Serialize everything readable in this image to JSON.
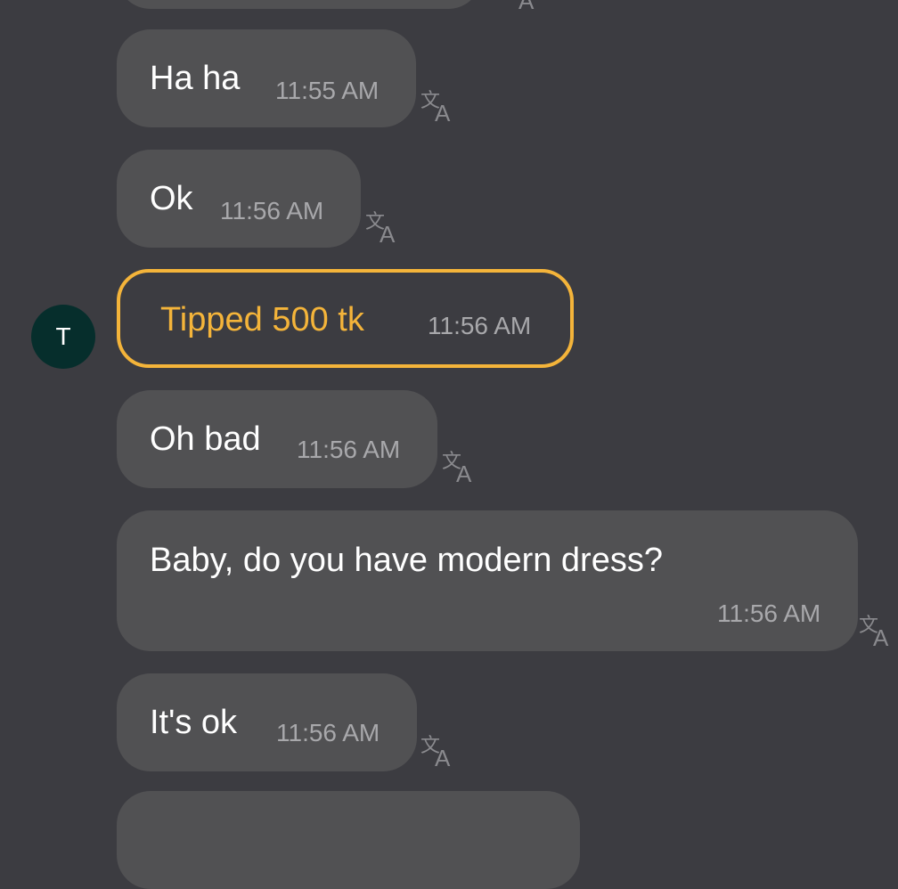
{
  "messages": [
    {
      "text": "Ha ha",
      "time": "11:55 AM"
    },
    {
      "text": "Ok",
      "time": "11:56 AM"
    },
    {
      "text": "Oh bad",
      "time": "11:56 AM"
    },
    {
      "text": "Baby, do you have modern dress?",
      "time": "11:56 AM"
    },
    {
      "text": "It's ok",
      "time": "11:56 AM"
    }
  ],
  "tip": {
    "text": "Tipped 500 tk",
    "time": "11:56 AM"
  },
  "avatar": {
    "initial": "T",
    "color": "#062e2c"
  },
  "colors": {
    "background": "#3c3c41",
    "bubble": "#515153",
    "tip_accent": "#f4b43a",
    "timestamp": "#a8a8ab"
  },
  "icons": {
    "translate": "translate-icon"
  }
}
